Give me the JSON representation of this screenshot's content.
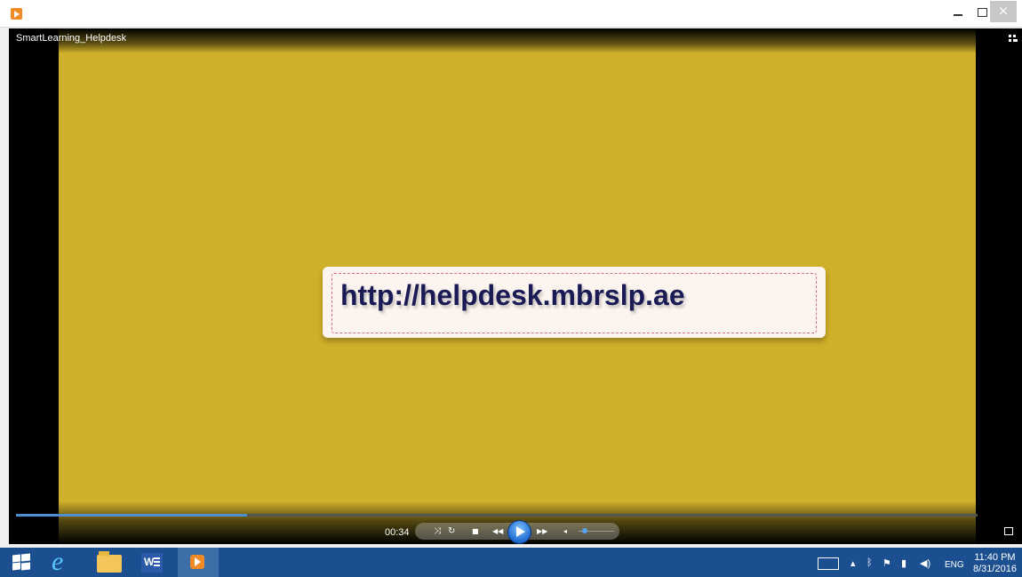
{
  "window": {
    "minimize_glyph": "",
    "maximize_glyph": "",
    "close_glyph": "×"
  },
  "player": {
    "title": "SmartLearning_Helpdesk",
    "time": "00:34",
    "progress_fraction": 0.24,
    "volume_fraction": 0.1
  },
  "video": {
    "url_text": "http://helpdesk.mbrslp.ae",
    "background_color": "#cfb02a"
  },
  "taskbar": {
    "language": "ENG",
    "time": "11:40 PM",
    "date": "8/31/2016",
    "pinned_icons": [
      "windows-logo",
      "internet-explorer",
      "file-explorer",
      "word",
      "media-player"
    ],
    "tray_icons": [
      "keyboard",
      "show-hidden",
      "bluetooth",
      "action-center-flag",
      "network",
      "volume"
    ]
  }
}
